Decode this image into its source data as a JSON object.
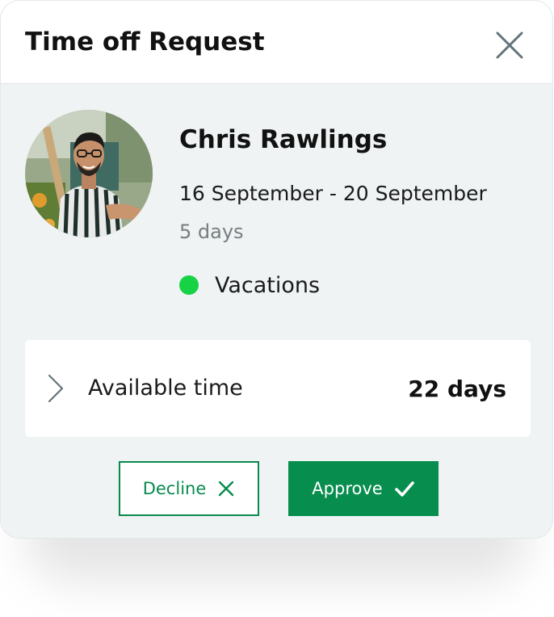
{
  "dialog": {
    "title": "Time off Request"
  },
  "request": {
    "name": "Chris Rawlings",
    "dates": "16 September - 20 September",
    "duration": "5 days",
    "type": "Vacations",
    "type_color": "#18d246"
  },
  "balance": {
    "label": "Available time",
    "value": "22 days"
  },
  "actions": {
    "decline_label": "Decline",
    "approve_label": "Approve",
    "accent": "#078d4e"
  },
  "icons": {
    "close": "close-icon",
    "expand": "chevron-right-icon",
    "decline": "x-icon",
    "approve": "check-icon"
  }
}
